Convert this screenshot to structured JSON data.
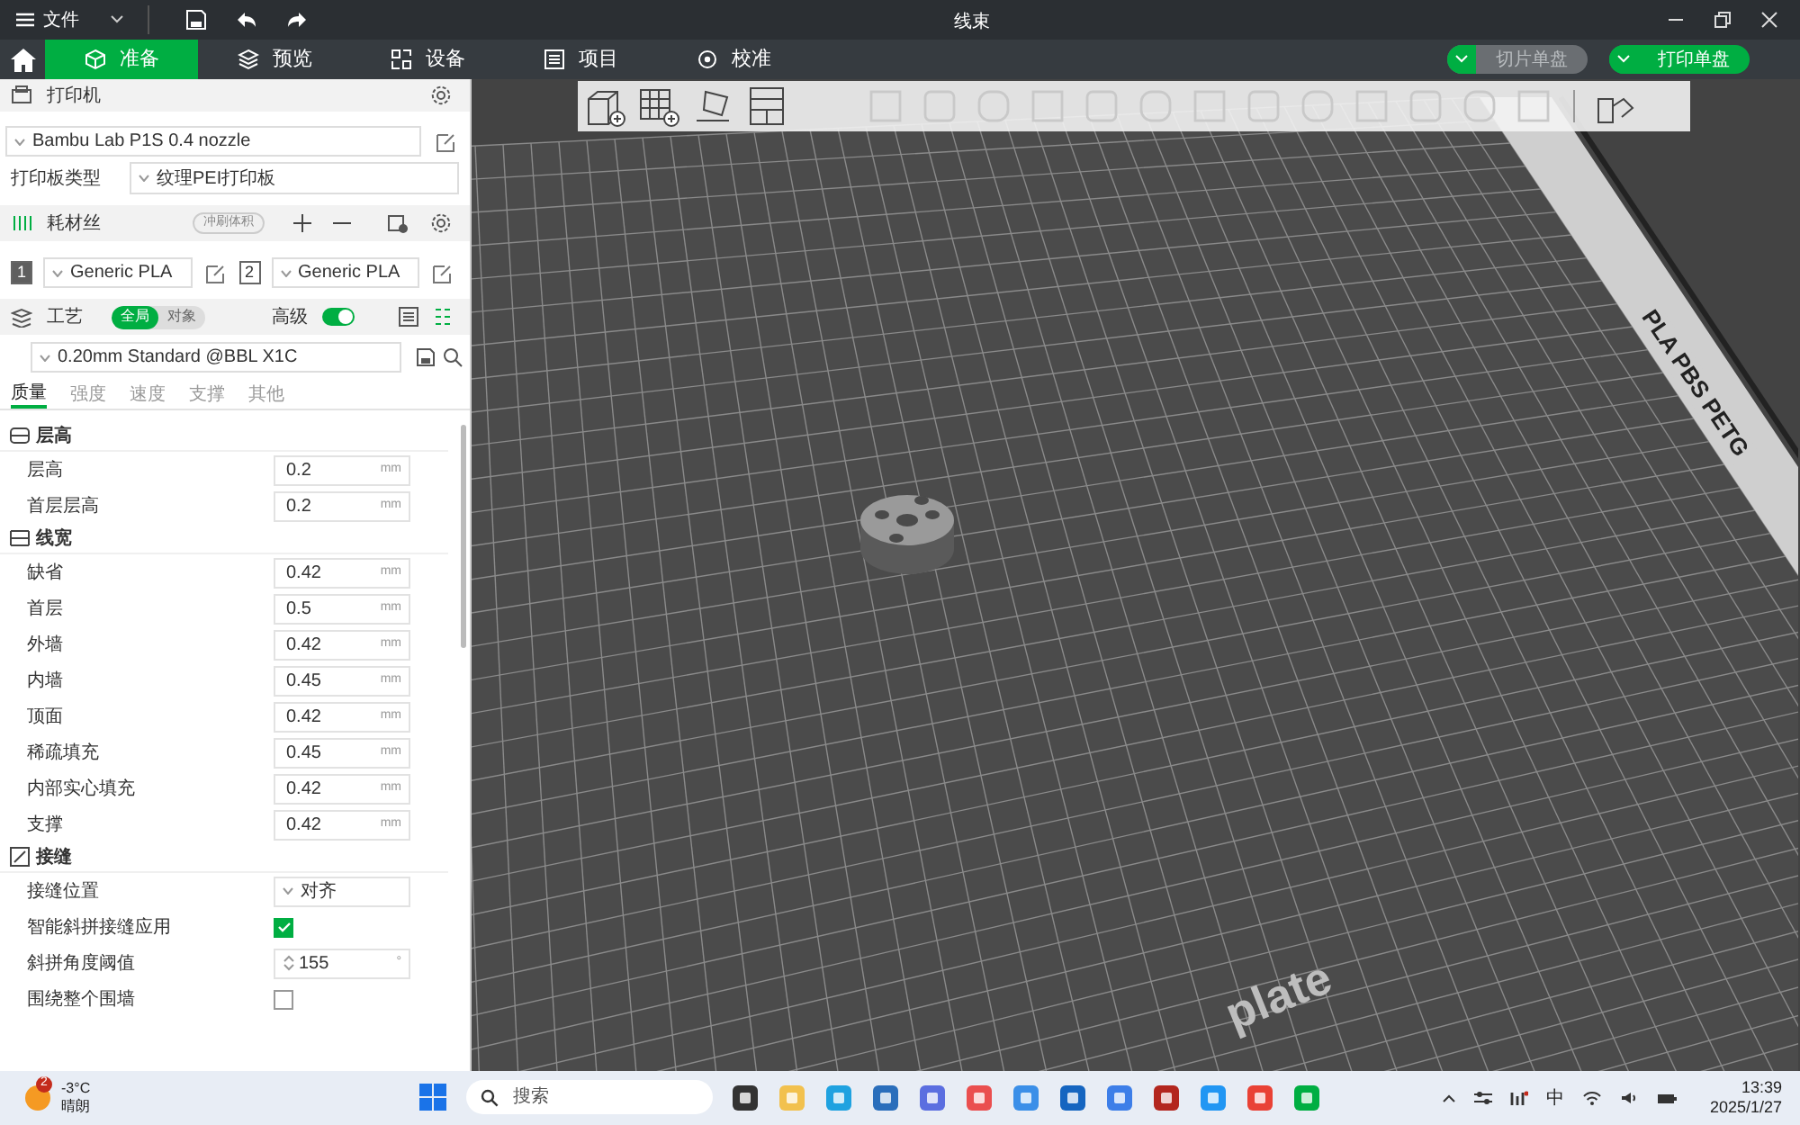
{
  "window": {
    "menu": "文件",
    "title": "线束"
  },
  "tabs": [
    {
      "label": "准备",
      "selected": true
    },
    {
      "label": "预览",
      "selected": false
    },
    {
      "label": "设备",
      "selected": false
    },
    {
      "label": "项目",
      "selected": false
    },
    {
      "label": "校准",
      "selected": false
    }
  ],
  "actions": [
    {
      "label": "切片单盘",
      "disabled": true
    },
    {
      "label": "打印单盘",
      "disabled": false
    }
  ],
  "printer": {
    "title": "打印机",
    "model": "Bambu Lab P1S 0.4 nozzle",
    "plate_label": "打印板类型",
    "plate_value": "纹理PEI打印板"
  },
  "filament": {
    "title": "耗材丝",
    "badge": "冲刷体积",
    "slots": [
      {
        "index": "1",
        "name": "Generic PLA",
        "color": "#5f5f5f"
      },
      {
        "index": "2",
        "name": "Generic PLA",
        "color": "#ffffff"
      }
    ]
  },
  "process": {
    "title": "工艺",
    "scope": [
      {
        "label": "全局",
        "selected": true
      },
      {
        "label": "对象",
        "selected": false
      }
    ],
    "advanced_label": "高级",
    "advanced_on": true,
    "preset": "0.20mm Standard @BBL X1C"
  },
  "setting_tabs": [
    {
      "label": "质量",
      "selected": true
    },
    {
      "label": "强度",
      "selected": false
    },
    {
      "label": "速度",
      "selected": false
    },
    {
      "label": "支撑",
      "selected": false
    },
    {
      "label": "其他",
      "selected": false
    }
  ],
  "groups": [
    {
      "title": "层高",
      "rows": [
        {
          "kind": "number",
          "label": "层高",
          "value": "0.2",
          "unit": "mm"
        },
        {
          "kind": "number",
          "label": "首层层高",
          "value": "0.2",
          "unit": "mm"
        }
      ]
    },
    {
      "title": "线宽",
      "rows": [
        {
          "kind": "number",
          "label": "缺省",
          "value": "0.42",
          "unit": "mm"
        },
        {
          "kind": "number",
          "label": "首层",
          "value": "0.5",
          "unit": "mm"
        },
        {
          "kind": "number",
          "label": "外墙",
          "value": "0.42",
          "unit": "mm"
        },
        {
          "kind": "number",
          "label": "内墙",
          "value": "0.45",
          "unit": "mm"
        },
        {
          "kind": "number",
          "label": "顶面",
          "value": "0.42",
          "unit": "mm"
        },
        {
          "kind": "number",
          "label": "稀疏填充",
          "value": "0.45",
          "unit": "mm"
        },
        {
          "kind": "number",
          "label": "内部实心填充",
          "value": "0.42",
          "unit": "mm"
        },
        {
          "kind": "number",
          "label": "支撑",
          "value": "0.42",
          "unit": "mm"
        }
      ]
    },
    {
      "title": "接缝",
      "rows": [
        {
          "kind": "select",
          "label": "接缝位置",
          "value": "对齐"
        },
        {
          "kind": "checkbox",
          "label": "智能斜拼接缝应用",
          "checked": true
        },
        {
          "kind": "spinner",
          "label": "斜拼角度阈值",
          "value": "155",
          "unit": "°"
        },
        {
          "kind": "checkbox",
          "label": "围绕整个围墙",
          "checked": false
        }
      ]
    }
  ],
  "viewport": {
    "plate_labels": [
      "PLA PBS PETG",
      "plate"
    ]
  },
  "taskbar": {
    "weather_badge": "2",
    "temperature": "-3°C",
    "condition": "晴朗",
    "search": "搜索",
    "ime": "中",
    "time": "13:39",
    "date": "2025/1/27"
  }
}
